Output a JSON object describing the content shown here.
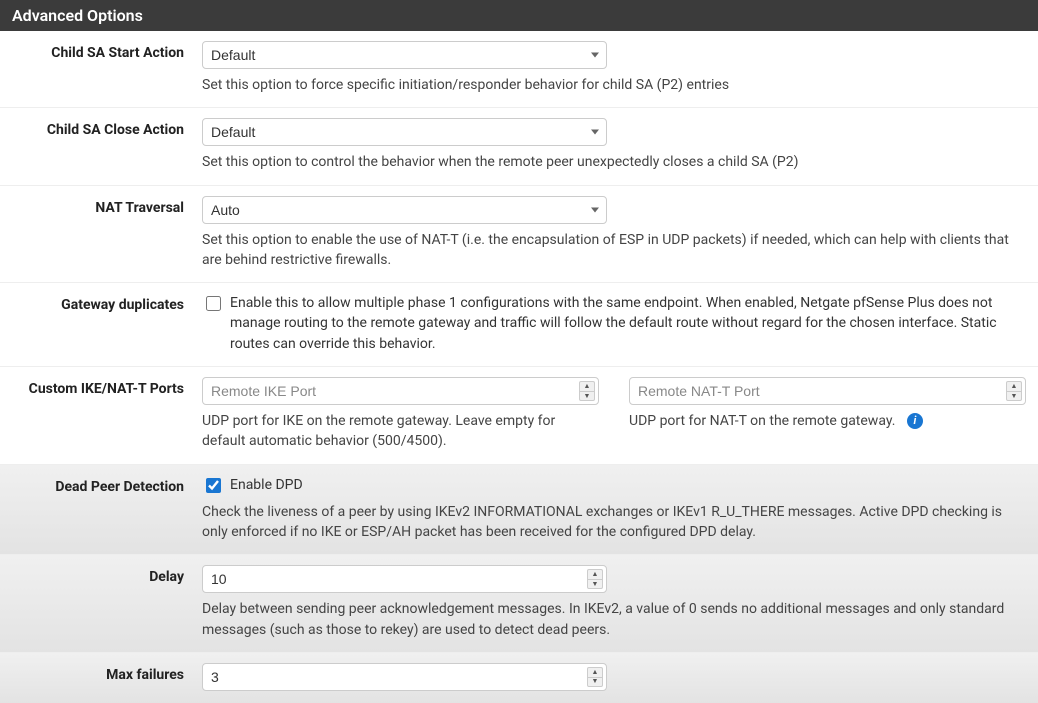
{
  "panel": {
    "title": "Advanced Options"
  },
  "childSaStart": {
    "label": "Child SA Start Action",
    "value": "Default",
    "help": "Set this option to force specific initiation/responder behavior for child SA (P2) entries"
  },
  "childSaClose": {
    "label": "Child SA Close Action",
    "value": "Default",
    "help": "Set this option to control the behavior when the remote peer unexpectedly closes a child SA (P2)"
  },
  "natTraversal": {
    "label": "NAT Traversal",
    "value": "Auto",
    "help": "Set this option to enable the use of NAT-T (i.e. the encapsulation of ESP in UDP packets) if needed, which can help with clients that are behind restrictive firewalls."
  },
  "gatewayDuplicates": {
    "label": "Gateway duplicates",
    "checkboxText": "Enable this to allow multiple phase 1 configurations with the same endpoint. When enabled, Netgate pfSense Plus does not manage routing to the remote gateway and traffic will follow the default route without regard for the chosen interface. Static routes can override this behavior."
  },
  "customPorts": {
    "label": "Custom IKE/NAT-T Ports",
    "ikePlaceholder": "Remote IKE Port",
    "ikeHelp": "UDP port for IKE on the remote gateway. Leave empty for default automatic behavior (500/4500).",
    "nattPlaceholder": "Remote NAT-T Port",
    "nattHelp": "UDP port for NAT-T on the remote gateway."
  },
  "dpd": {
    "label": "Dead Peer Detection",
    "checkboxText": "Enable DPD",
    "help": "Check the liveness of a peer by using IKEv2 INFORMATIONAL exchanges or IKEv1 R_U_THERE messages. Active DPD checking is only enforced if no IKE or ESP/AH packet has been received for the configured DPD delay."
  },
  "delay": {
    "label": "Delay",
    "value": "10",
    "help": "Delay between sending peer acknowledgement messages. In IKEv2, a value of 0 sends no additional messages and only standard messages (such as those to rekey) are used to detect dead peers."
  },
  "maxFailures": {
    "label": "Max failures",
    "value": "3"
  }
}
